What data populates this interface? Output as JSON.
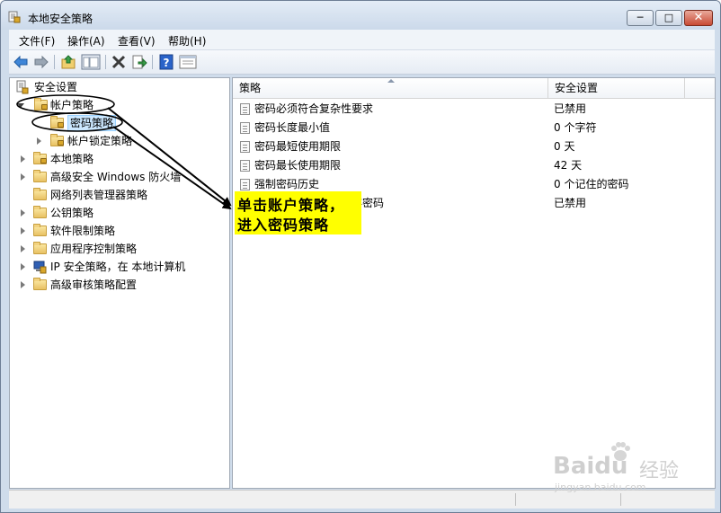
{
  "window": {
    "title": "本地安全策略"
  },
  "window_controls": {
    "minimize": "─",
    "maximize": "□",
    "close": "✕"
  },
  "menu": {
    "items": [
      "文件(F)",
      "操作(A)",
      "查看(V)",
      "帮助(H)"
    ]
  },
  "toolbar": {
    "icons": [
      "back-arrow-icon",
      "forward-arrow-icon",
      "up-folder-icon",
      "show-tree-icon",
      "delete-icon",
      "export-icon",
      "help-icon",
      "properties-icon"
    ]
  },
  "tree": {
    "root": "安全设置",
    "items": [
      {
        "label": "帐户策略",
        "state": "expanded"
      },
      {
        "label": "密码策略",
        "state": "selected"
      },
      {
        "label": "帐户锁定策略",
        "state": "collapsed"
      },
      {
        "label": "本地策略",
        "state": "collapsed"
      },
      {
        "label": "高级安全 Windows 防火墙",
        "state": "collapsed"
      },
      {
        "label": "网络列表管理器策略",
        "state": "leaf"
      },
      {
        "label": "公钥策略",
        "state": "collapsed"
      },
      {
        "label": "软件限制策略",
        "state": "collapsed"
      },
      {
        "label": "应用程序控制策略",
        "state": "collapsed"
      },
      {
        "label": "IP 安全策略，在 本地计算机",
        "state": "collapsed"
      },
      {
        "label": "高级审核策略配置",
        "state": "collapsed"
      }
    ]
  },
  "policy_table": {
    "columns": [
      "策略",
      "安全设置"
    ],
    "rows": [
      {
        "policy": "密码必须符合复杂性要求",
        "setting": "已禁用"
      },
      {
        "policy": "密码长度最小值",
        "setting": "0 个字符"
      },
      {
        "policy": "密码最短使用期限",
        "setting": "0 天"
      },
      {
        "policy": "密码最长使用期限",
        "setting": "42 天"
      },
      {
        "policy": "强制密码历史",
        "setting": "0 个记住的密码"
      },
      {
        "policy": "用可还原的加密来储存密码",
        "setting": "已禁用"
      }
    ]
  },
  "callout": {
    "line1": "单击账户策略，",
    "line2": "进入密码策略"
  },
  "watermark": {
    "brand": "Baidu",
    "cn": "经验",
    "url": "jingyan.baidu.com"
  },
  "colors": {
    "callout_bg": "#ffff00",
    "annotation": "#000000",
    "selection": "#cce8ff",
    "close_button": "#c84a34"
  }
}
